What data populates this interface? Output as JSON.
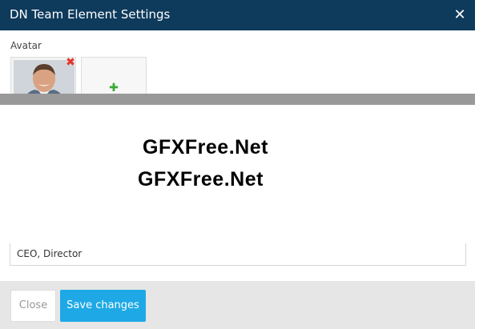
{
  "dialog": {
    "title": "DN Team Element Settings",
    "close_icon": "close-icon"
  },
  "avatar": {
    "label": "Avatar",
    "remove_icon": "remove-icon",
    "add_icon": "plus-icon"
  },
  "watermark": {
    "line1": "GFXFree.Net",
    "line2": "GFXFree.Net"
  },
  "field": {
    "value": "CEO, Director"
  },
  "footer": {
    "close_label": "Close",
    "save_label": "Save changes"
  },
  "colors": {
    "titlebar": "#0e3a5c",
    "save_button": "#1ea9e6",
    "remove": "#e5332a",
    "add": "#3aaa35"
  }
}
